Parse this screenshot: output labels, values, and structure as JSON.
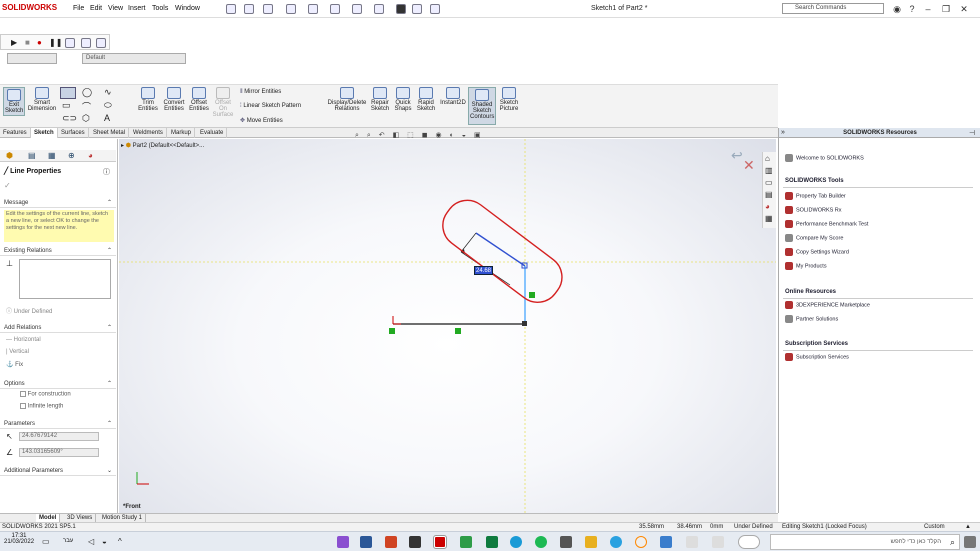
{
  "app": {
    "logo": "SOLIDWORKS",
    "window_title": "Sketch1 of Part2 *",
    "menus": [
      "File",
      "Edit",
      "View",
      "Insert",
      "Tools",
      "Window"
    ],
    "search_placeholder": "Search Commands",
    "help": "?"
  },
  "config_combo": "Default",
  "command_bar": {
    "buttons": [
      {
        "label": "Exit Sketch",
        "icon": "exit-sketch-icon"
      },
      {
        "label": "Smart Dimension",
        "icon": "smart-dimension-icon"
      },
      {
        "label": "Trim Entities",
        "icon": "trim-icon"
      },
      {
        "label": "Convert Entities",
        "icon": "convert-icon"
      },
      {
        "label": "Offset Entities",
        "icon": "offset-icon"
      },
      {
        "label": "Offset On Surface",
        "icon": "offset-surface-icon"
      },
      {
        "label": "Display/Delete Relations",
        "icon": "relations-icon"
      },
      {
        "label": "Repair Sketch",
        "icon": "repair-icon"
      },
      {
        "label": "Quick Snaps",
        "icon": "snaps-icon"
      },
      {
        "label": "Rapid Sketch",
        "icon": "rapid-sketch-icon"
      },
      {
        "label": "Instant2D",
        "icon": "instant2d-icon"
      },
      {
        "label": "Shaded Sketch Contours",
        "icon": "shaded-contours-icon"
      },
      {
        "label": "Sketch Picture",
        "icon": "sketch-picture-icon"
      }
    ],
    "small": [
      "Mirror Entities",
      "Linear Sketch Pattern",
      "Move Entities"
    ]
  },
  "tabs": [
    "Features",
    "Sketch",
    "Surfaces",
    "Sheet Metal",
    "Weldments",
    "Markup",
    "Evaluate"
  ],
  "active_tab": "Sketch",
  "property_manager": {
    "title": "Line Properties",
    "message_header": "Message",
    "message": "Edit the settings of the current line, sketch a new line, or select OK to change the settings for the next new line.",
    "existing_relations": "Existing Relations",
    "under_defined": "Under Defined",
    "add_relations": "Add Relations",
    "relations": [
      "Horizontal",
      "Vertical",
      "Fix"
    ],
    "options": "Options",
    "option_items": [
      "For construction",
      "Infinite length"
    ],
    "parameters": "Parameters",
    "param_length": "24.67679142",
    "param_angle": "143.03165609°",
    "additional_parameters": "Additional Parameters"
  },
  "viewport": {
    "tree_label": "Part2  (Default<<Default>...",
    "dimension_value": "24.68",
    "view_label": "*Front"
  },
  "resources": {
    "title": "SOLIDWORKS Resources",
    "welcome": "Welcome to SOLIDWORKS",
    "tools_header": "SOLIDWORKS Tools",
    "tools": [
      "Property Tab Builder",
      "SOLIDWORKS Rx",
      "Performance Benchmark Test",
      "Compare My Score",
      "Copy Settings Wizard",
      "My Products"
    ],
    "online_header": "Online Resources",
    "online": [
      "3DEXPERIENCE Marketplace",
      "Partner Solutions"
    ],
    "subscription_header": "Subscription Services",
    "subscription": [
      "Subscription Services"
    ]
  },
  "bottom_tabs": [
    "Model",
    "3D Views",
    "Motion Study 1"
  ],
  "status": {
    "version": "SOLIDWORKS 2021 SP5.1",
    "x": "35.58mm",
    "y": "38.46mm",
    "z": "0mm",
    "state": "Under Defined",
    "editing": "Editing Sketch1 (Locked Focus)",
    "units": "Custom"
  },
  "taskbar": {
    "time": "17:31",
    "date": "21/03/2022",
    "lang": "עבר",
    "search": "הקלד כאן כדי לחפש"
  },
  "colors": {
    "accent": "#c00000",
    "highlight_circle": "#d42020",
    "sketch_line": "#1a1a1a",
    "selected_line": "#3050d0",
    "message_bg": "#fffbb0"
  }
}
